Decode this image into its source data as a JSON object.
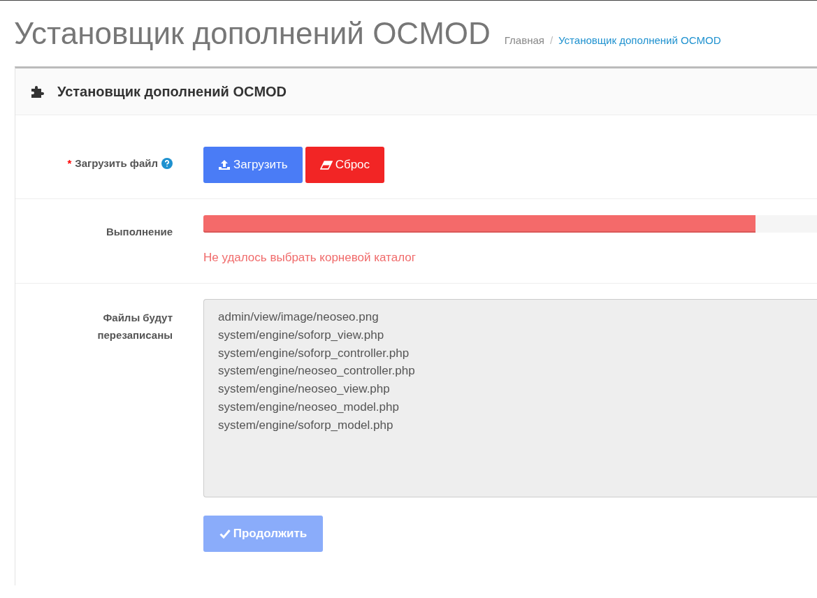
{
  "page_title": "Установщик дополнений OCMOD",
  "breadcrumb_separator": "/",
  "breadcrumb": [
    {
      "label": "Главная",
      "selected": false
    },
    {
      "label": "Установщик дополнений OCMOD",
      "selected": true
    }
  ],
  "panel": {
    "title": "Установщик дополнений OCMOD"
  },
  "upload": {
    "label": "Загрузить файл",
    "required_mark": "*",
    "upload_button": "Загрузить",
    "reset_button": "Сброс"
  },
  "progress": {
    "label": "Выполнение",
    "level": 0.9,
    "error": "Не удалось выбрать корневой каталог"
  },
  "overwrite": {
    "label": "Файлы будут перезаписаны",
    "files": [
      "admin/view/image/neoseo.png",
      "system/engine/soforp_view.php",
      "system/engine/soforp_controller.php",
      "system/engine/neoseo_controller.php",
      "system/engine/neoseo_view.php",
      "system/engine/neoseo_model.php",
      "system/engine/soforp_model.php"
    ]
  },
  "continue_button": {
    "label": "Продолжить",
    "disabled": true
  }
}
